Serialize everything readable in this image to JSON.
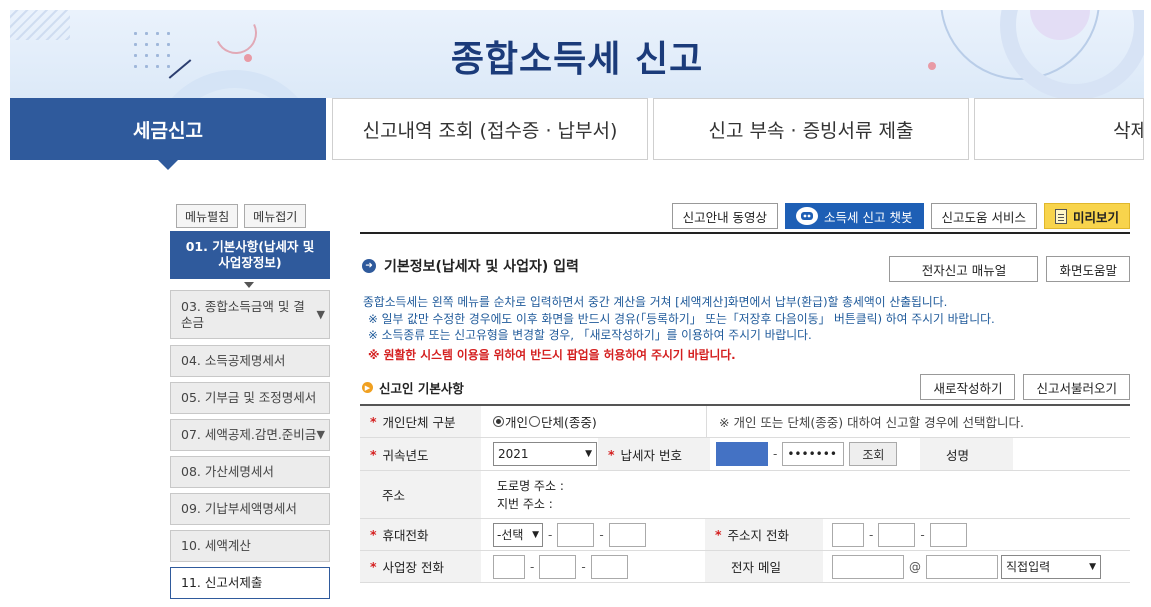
{
  "banner": {
    "title": "종합소득세 신고"
  },
  "tabs": [
    {
      "label": "세금신고"
    },
    {
      "label": "신고내역 조회 (접수증 · 납부서)"
    },
    {
      "label": "신고 부속 · 증빙서류 제출"
    },
    {
      "label": "삭제내역"
    }
  ],
  "menu_controls": {
    "expand": "메뉴펼침",
    "collapse": "메뉴접기"
  },
  "left_menu": [
    {
      "label": "01. 기본사항(납세자 및 사업장정보)"
    },
    {
      "label": "03. 종합소득금액 및 결손금"
    },
    {
      "label": "04. 소득공제명세서"
    },
    {
      "label": "05. 기부금 및 조정명세서"
    },
    {
      "label": "07. 세액공제.감면.준비금"
    },
    {
      "label": "08. 가산세명세서"
    },
    {
      "label": "09. 기납부세액명세서"
    },
    {
      "label": "10. 세액계산"
    },
    {
      "label": "11. 신고서제출"
    }
  ],
  "top_buttons": {
    "guide_video": "신고안내 동영상",
    "chatbot": "소득세 신고 챗봇",
    "help_service": "신고도움 서비스",
    "preview": "미리보기"
  },
  "section": {
    "title": "기본정보(납세자 및 사업자) 입력",
    "manual": "전자신고 매뉴얼",
    "screen_help": "화면도움말"
  },
  "notice": {
    "line1": "종합소득세는 왼쪽 메뉴를 순차로 입력하면서 중간 계산을 거쳐 [세액계산]화면에서 납부(환급)할 총세액이 산출됩니다.",
    "line2": "※ 일부 값만 수정한 경우에도 이후 화면을 반드시 경유(「등록하기」 또는「저장후 다음이동」 버튼클릭) 하여 주시기 바랍니다.",
    "line3": "※ 소득종류 또는 신고유형을 변경할 경우, 「새로작성하기」를 이용하여 주시기 바랍니다.",
    "line4": "※ 원활한 시스템 이용을 위하여 반드시 팝업을 허용하여 주시기 바랍니다."
  },
  "basic": {
    "title": "신고인 기본사항",
    "new_btn": "새로작성하기",
    "load_btn": "신고서불러오기"
  },
  "form": {
    "type_label": "개인단체 구분",
    "type_individual": "개인",
    "type_group": "단체(종중)",
    "type_hint": "※ 개인 또는 단체(종중) 대하여 신고할 경우에 선택합니다.",
    "year_label": "귀속년도",
    "year_value": "2021",
    "taxpayer_no_label": "납세자 번호",
    "taxpayer_no_masked": "•••••••",
    "lookup_btn": "조회",
    "name_label": "성명",
    "address_label": "주소",
    "road_address": "도로명 주소 :",
    "lot_address": "지번 주소 :",
    "mobile_label": "휴대전화",
    "mobile_select": "-선택",
    "home_phone_label": "주소지 전화",
    "biz_phone_label": "사업장 전화",
    "email_label": "전자 메일",
    "email_at": "@",
    "email_domain": "직접입력"
  },
  "colors": {
    "primary": "#2f5a9c",
    "accent_red": "#d41f1f",
    "notice_blue": "#1f5a9a",
    "preview_yellow": "#f8d44c"
  }
}
